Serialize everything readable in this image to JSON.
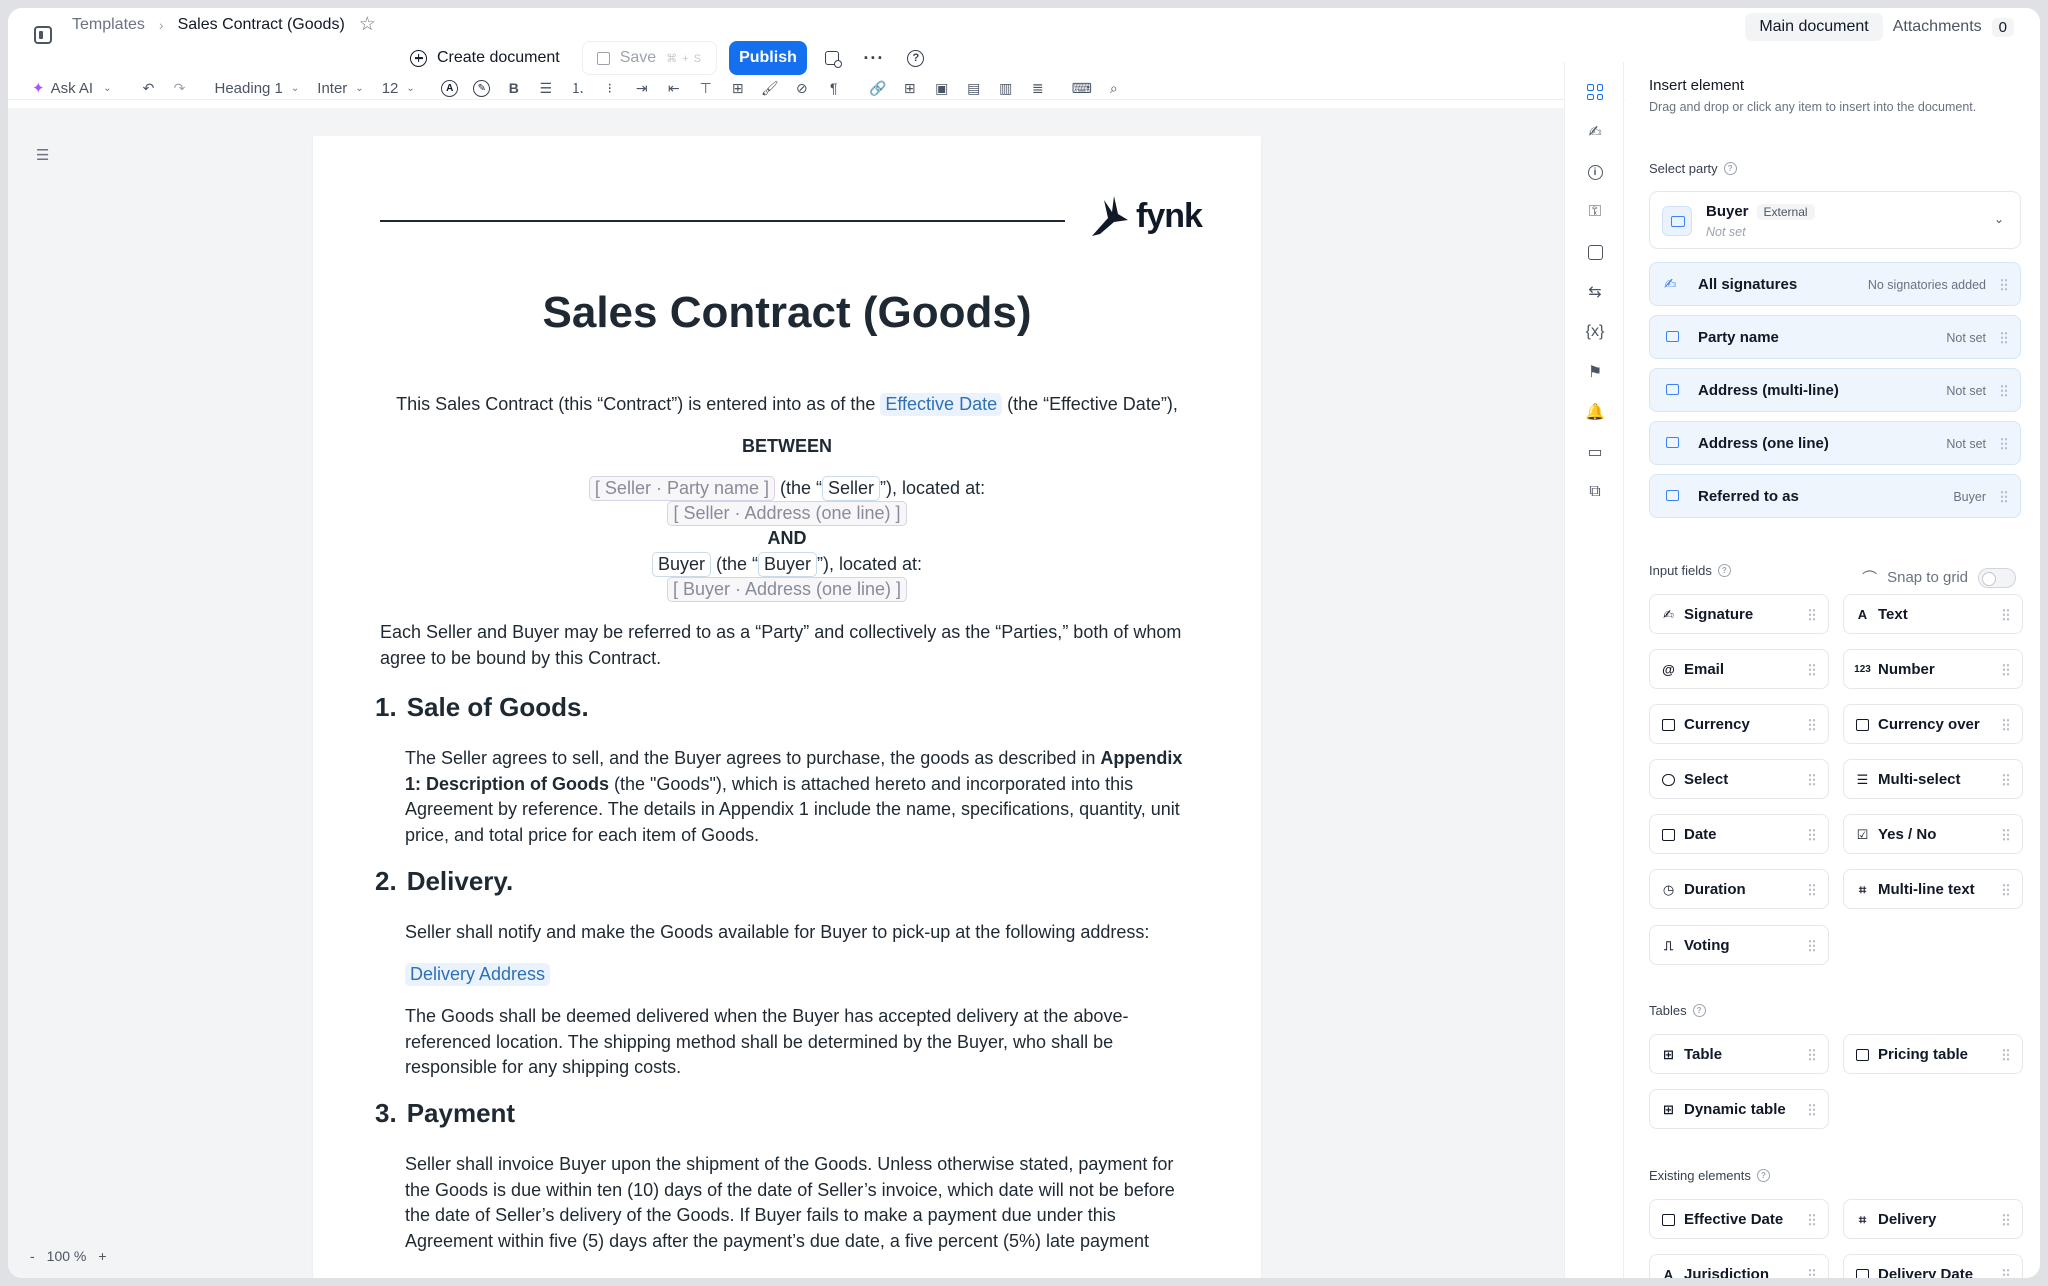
{
  "breadcrumb": {
    "parent": "Templates",
    "separator": "›",
    "current": "Sales Contract (Goods)"
  },
  "actions": {
    "create": "Create document",
    "save": "Save",
    "save_shortcut": "⌘ + S",
    "publish": "Publish",
    "more": "···",
    "help": "?"
  },
  "doc_tabs": {
    "main": "Main document",
    "attachments": "Attachments",
    "attachments_count": "0"
  },
  "toolbar": {
    "ask_ai": "Ask AI",
    "heading": "Heading 1",
    "font": "Inter",
    "size": "12",
    "bold": "B"
  },
  "zoom": {
    "minus": "-",
    "value": "100 %",
    "plus": "+"
  },
  "document": {
    "logo": "fynk",
    "title": "Sales Contract (Goods)",
    "intro_a": "This Sales Contract (this “Contract”) is entered into as of the ",
    "effective_date": "Effective Date",
    "intro_b": " (the “Effective Date”),",
    "between": "BETWEEN",
    "seller_party": "[ Seller · Party name ]",
    "seller_mid_a": " (the “",
    "seller_ref": "Seller",
    "seller_mid_b": "”), located at:",
    "seller_address": "[ Seller · Address (one line) ]",
    "and": "AND",
    "buyer_party": "Buyer",
    "buyer_mid_a": " (the “",
    "buyer_ref": "Buyer",
    "buyer_mid_b": "”), located at:",
    "buyer_address": "[ Buyer · Address (one line) ]",
    "parties_text": "Each Seller and Buyer may be referred to as a “Party” and collectively as the “Parties,” both of whom agree to be bound by this Contract.",
    "s1_num": "1.",
    "s1_title": "Sale of Goods.",
    "s1_a": "The Seller agrees to sell, and the Buyer agrees to purchase, the goods as described in ",
    "s1_bold": "Appendix 1: Description of Goods",
    "s1_b": " (the \"Goods\"), which is attached hereto and incorporated into this Agreement by reference. The details in Appendix 1 include the name, specifications, quantity, unit price, and total price for each item of Goods.",
    "s2_num": "2.",
    "s2_title": "Delivery.",
    "s2_a": "Seller shall notify and make the Goods available for Buyer to pick-up at the following address:",
    "delivery_address": "Delivery Address",
    "s2_b": "The Goods shall be deemed delivered when the Buyer has accepted delivery at the above-referenced location. The shipping method shall be determined by the Buyer, who shall be responsible for any shipping costs.",
    "s3_num": "3.",
    "s3_title": "Payment",
    "s3_a": "Seller shall invoice Buyer upon the shipment of the Goods. Unless otherwise stated, payment for the Goods is due within ten (10) days of the date of Seller’s invoice, which date will not be before the date of Seller’s delivery of the Goods. If Buyer fails to make a payment due under this Agreement within five (5) days after the payment’s due date, a five percent (5%) late payment"
  },
  "panel": {
    "title": "Insert element",
    "description": "Drag and drop or click any item to insert into the document.",
    "select_party_label": "Select party",
    "party": {
      "name": "Buyer",
      "badge": "External",
      "status": "Not set"
    },
    "party_rows": [
      {
        "label": "All signatures",
        "value": "No signatories added"
      },
      {
        "label": "Party name",
        "value": "Not set"
      },
      {
        "label": "Address (multi-line)",
        "value": "Not set"
      },
      {
        "label": "Address (one line)",
        "value": "Not set"
      },
      {
        "label": "Referred to as",
        "value": "Buyer"
      }
    ],
    "input_fields_label": "Input fields",
    "snap_to_grid": "Snap to grid",
    "input_fields": [
      "Signature",
      "Text",
      "Email",
      "Number",
      "Currency",
      "Currency over",
      "Select",
      "Multi-select",
      "Date",
      "Yes / No",
      "Duration",
      "Multi-line text",
      "Voting"
    ],
    "tables_label": "Tables",
    "tables": [
      "Table",
      "Pricing table",
      "Dynamic table"
    ],
    "existing_label": "Existing elements",
    "existing": [
      "Effective Date",
      "Delivery",
      "Jurisdiction",
      "Delivery Date"
    ]
  },
  "colors": {
    "accent": "#1570ef",
    "chip_bg": "#eaf3fd",
    "party_row_bg": "#eef5fd"
  }
}
